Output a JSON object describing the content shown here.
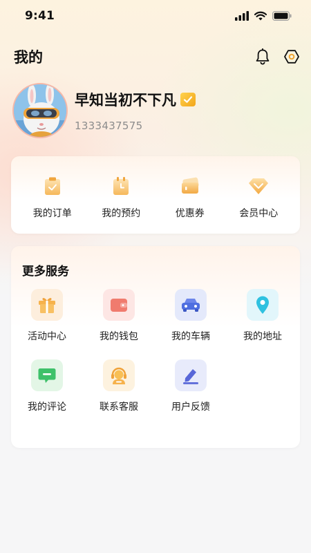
{
  "status_bar": {
    "time": "9:41"
  },
  "header": {
    "title": "我的"
  },
  "profile": {
    "name": "早知当初不下凡",
    "phone": "1333437575"
  },
  "quick_actions": [
    {
      "label": "我的订单",
      "icon": "order-icon"
    },
    {
      "label": "我的预约",
      "icon": "appointment-icon"
    },
    {
      "label": "优惠券",
      "icon": "coupon-icon"
    },
    {
      "label": "会员中心",
      "icon": "diamond-icon"
    }
  ],
  "services": {
    "title": "更多服务",
    "items": [
      {
        "label": "活动中心",
        "icon": "gift-icon",
        "tile_color": "#fdeedd"
      },
      {
        "label": "我的钱包",
        "icon": "wallet-icon",
        "tile_color": "#fde6e4"
      },
      {
        "label": "我的车辆",
        "icon": "car-icon",
        "tile_color": "#e4e9fb"
      },
      {
        "label": "我的地址",
        "icon": "location-pin-icon",
        "tile_color": "#e2f6fb"
      },
      {
        "label": "我的评论",
        "icon": "comment-icon",
        "tile_color": "#e3f6e6"
      },
      {
        "label": "联系客服",
        "icon": "customer-service-icon",
        "tile_color": "#fdf2df"
      },
      {
        "label": "用户反馈",
        "icon": "feedback-icon",
        "tile_color": "#e8ebfb"
      }
    ]
  },
  "colors": {
    "accent_orange": "#f5b24a",
    "wallet_red": "#f07b6e",
    "car_blue": "#4f6fe0",
    "pin_cyan": "#2fc1e0",
    "comment_green": "#3ec16a",
    "feedback_indigo": "#5867d8"
  }
}
